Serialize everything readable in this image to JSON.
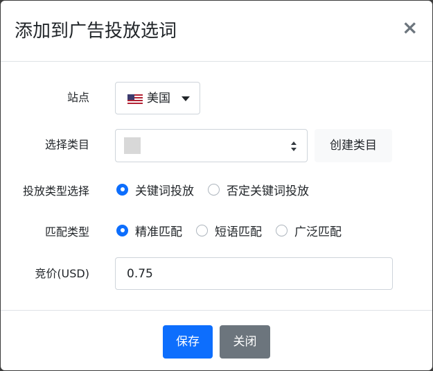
{
  "header": {
    "title": "添加到广告投放选词",
    "close_symbol": "×"
  },
  "form": {
    "site": {
      "label": "站点",
      "value": "美国",
      "icon": "us-flag-icon"
    },
    "category": {
      "label": "选择类目",
      "value": "",
      "create_button": "创建类目"
    },
    "targeting_type": {
      "label": "投放类型选择",
      "options": [
        {
          "label": "关键词投放",
          "checked": true
        },
        {
          "label": "否定关键词投放",
          "checked": false
        }
      ]
    },
    "match_type": {
      "label": "匹配类型",
      "options": [
        {
          "label": "精准匹配",
          "checked": true
        },
        {
          "label": "短语匹配",
          "checked": false
        },
        {
          "label": "广泛匹配",
          "checked": false
        }
      ]
    },
    "bid": {
      "label": "竞价(USD)",
      "value": "0.75"
    }
  },
  "footer": {
    "save_label": "保存",
    "close_label": "关闭"
  },
  "colors": {
    "primary": "#0d6efd",
    "secondary": "#6c757d",
    "border": "#ced4da"
  }
}
